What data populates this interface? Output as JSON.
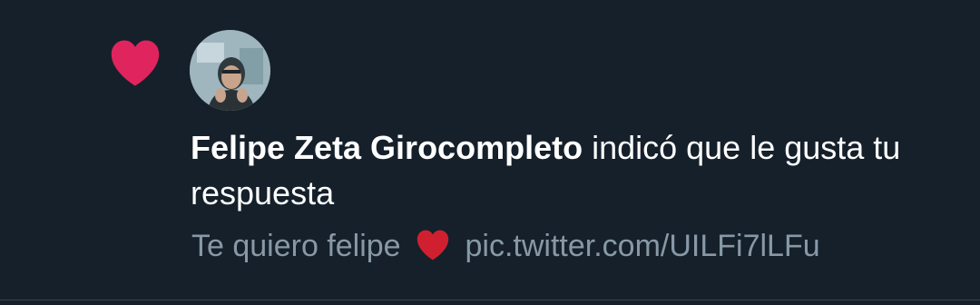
{
  "notification": {
    "type_icon": "heart-icon",
    "type_icon_color": "#e0245e",
    "actor_name": "Felipe Zeta Girocompleto",
    "action_text": " indicó que le gusta tu respuesta",
    "preview": {
      "text_before": "Te quiero felipe",
      "emoji_icon": "red-heart-emoji-icon",
      "emoji_color": "#dd2e44",
      "link": "pic.twitter.com/UILFi7lLFu"
    }
  },
  "colors": {
    "background": "#15202b",
    "primary_text": "#ffffff",
    "secondary_text": "#8899a6",
    "divider": "#38444d"
  }
}
